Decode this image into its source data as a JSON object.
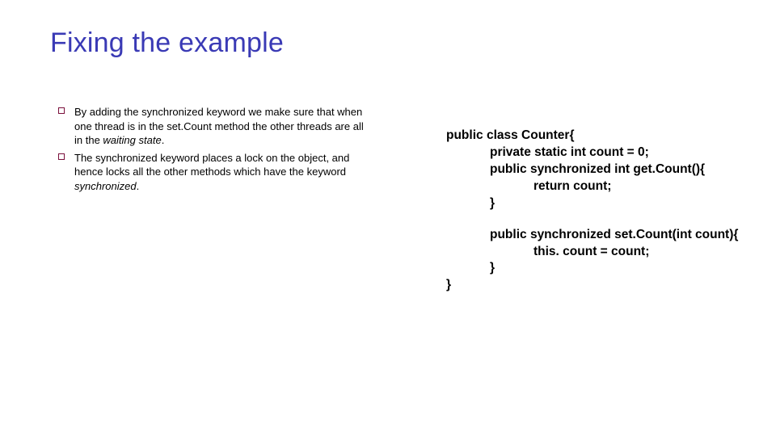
{
  "title": "Fixing the example",
  "bullets": [
    {
      "prefix": "By adding the synchronized keyword we make sure that when one thread is in the set.Count method the other threads are all in the ",
      "italic": "waiting state",
      "suffix": "."
    },
    {
      "prefix": "The synchronized keyword places a lock on the object, and hence locks all the other methods which have the keyword ",
      "italic": "synchronized",
      "suffix": "."
    }
  ],
  "code": {
    "l1": "public class Counter{",
    "l2": "private static int count = 0;",
    "l3": "public synchronized int get.Count(){",
    "l4": "return count;",
    "l5": "}",
    "l6": "public synchronized set.Count(int count){",
    "l7": "this. count = count;",
    "l8": "}",
    "l9": "}"
  }
}
